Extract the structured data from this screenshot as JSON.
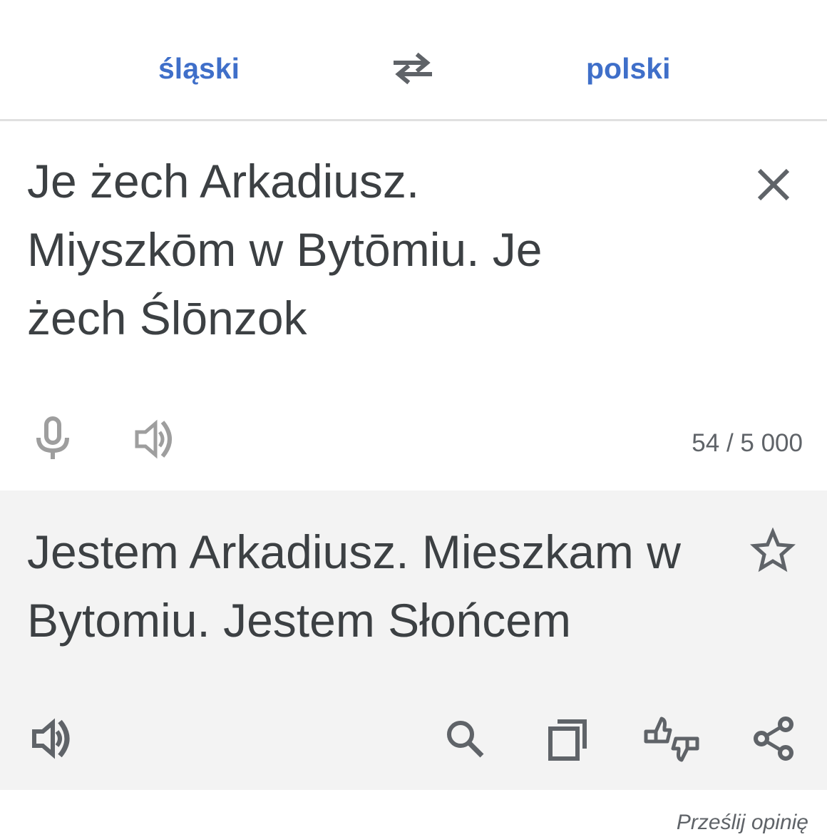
{
  "lang_bar": {
    "source_lang": "śląski",
    "target_lang": "polski",
    "swap_icon": "swap-arrows-icon"
  },
  "source": {
    "text": "Je żech Arkadiusz.\nMiyszkōm w Bytōmiu. Je\nżech Ślōnzok",
    "char_count": "54 / 5 000",
    "icons": [
      "close-icon",
      "microphone-icon",
      "speaker-icon"
    ]
  },
  "result": {
    "text": "Jestem Arkadiusz. Mieszkam\nw Bytomiu. Jestem Słońcem",
    "icons": [
      "star-icon",
      "speaker-icon",
      "search-icon",
      "copy-icon",
      "thumbs-up-down-icon",
      "share-icon"
    ]
  },
  "footer": {
    "feedback_label": "Prześlij opinię"
  },
  "colors": {
    "accent": "#3f6fc9",
    "text": "#3c4043",
    "result_bg": "#f3f3f3",
    "icon_disabled": "#9e9e9e",
    "icon": "#5f6368"
  }
}
